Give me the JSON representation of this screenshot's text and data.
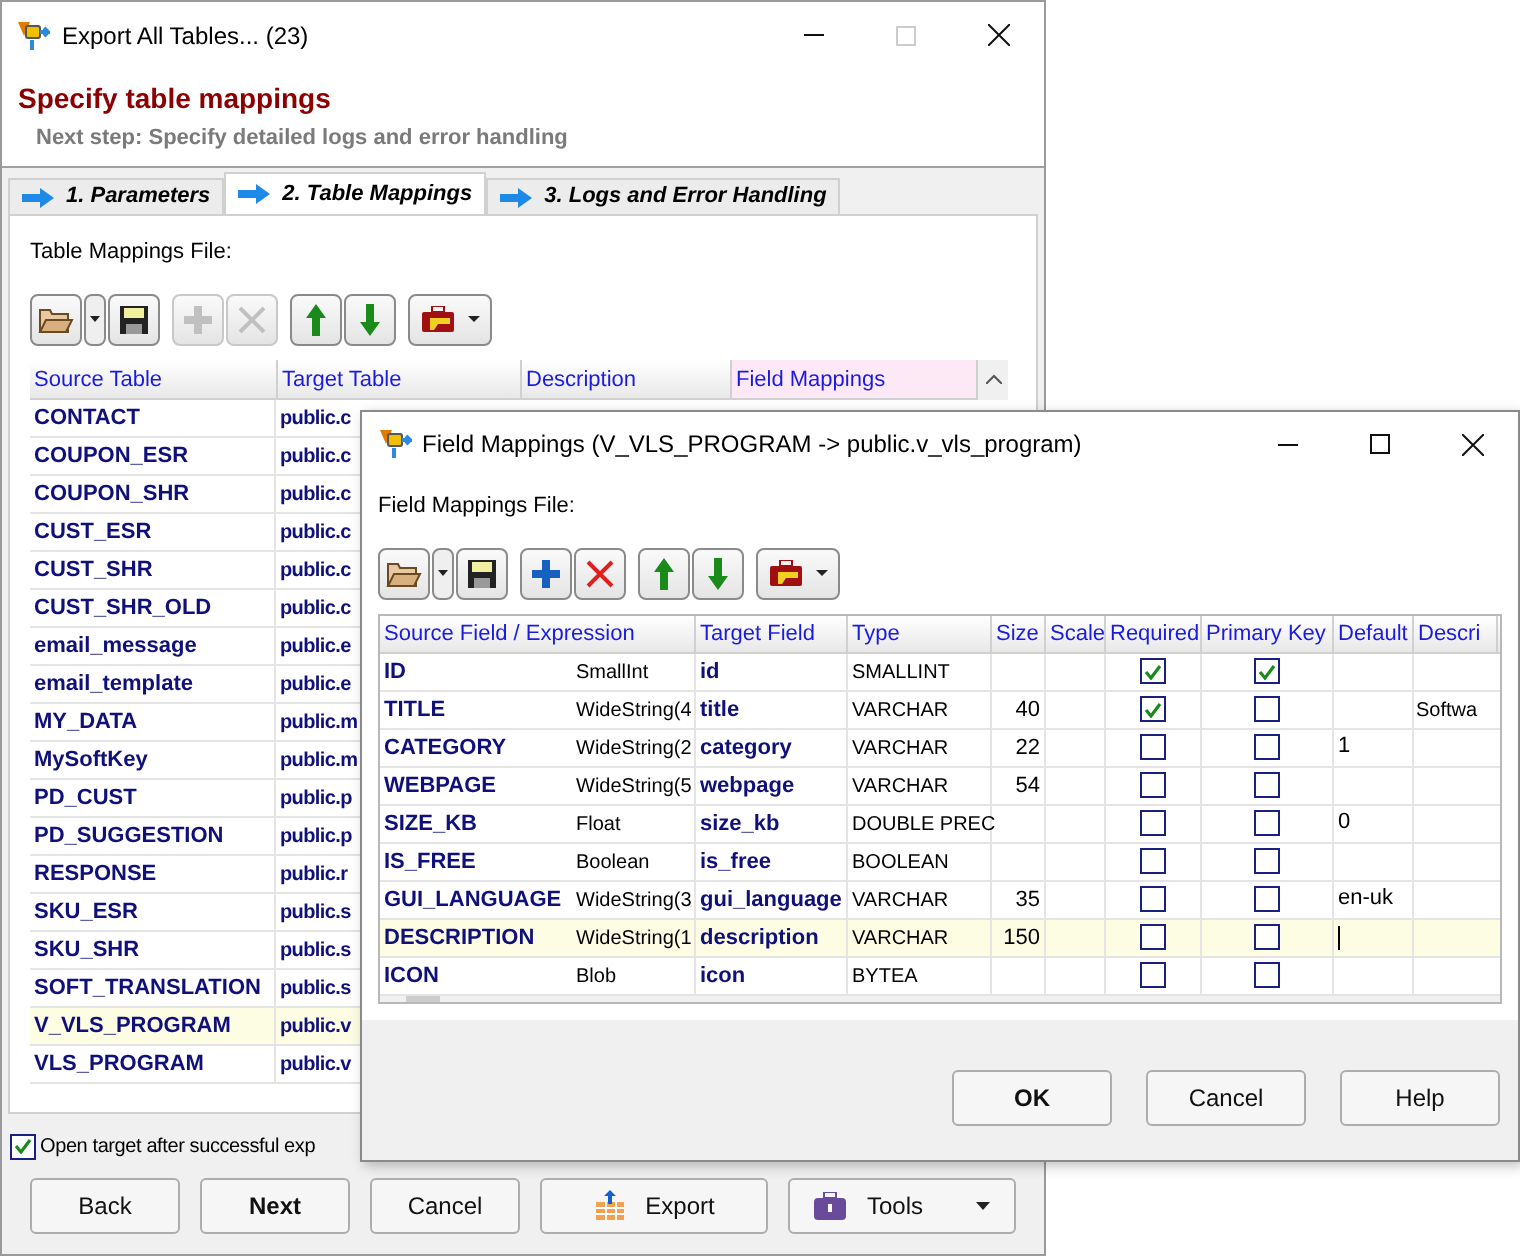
{
  "window": {
    "title": "Export All Tables... (23)"
  },
  "header": {
    "title": "Specify table mappings",
    "subtitle": "Next step: Specify detailed logs and error handling"
  },
  "tabs": [
    {
      "label": "1. Parameters",
      "selected": false
    },
    {
      "label": "2. Table Mappings",
      "selected": true
    },
    {
      "label": "3. Logs and Error Handling",
      "selected": false
    }
  ],
  "file_label": "Table Mappings File:",
  "table": {
    "columns": [
      "Source Table",
      "Target Table",
      "Description",
      "Field Mappings"
    ],
    "rows": [
      {
        "source": "CONTACT",
        "target": "public.c",
        "selected": false
      },
      {
        "source": "COUPON_ESR",
        "target": "public.c",
        "selected": false
      },
      {
        "source": "COUPON_SHR",
        "target": "public.c",
        "selected": false
      },
      {
        "source": "CUST_ESR",
        "target": "public.c",
        "selected": false
      },
      {
        "source": "CUST_SHR",
        "target": "public.c",
        "selected": false
      },
      {
        "source": "CUST_SHR_OLD",
        "target": "public.c",
        "selected": false
      },
      {
        "source": "email_message",
        "target": "public.e",
        "selected": false
      },
      {
        "source": "email_template",
        "target": "public.e",
        "selected": false
      },
      {
        "source": "MY_DATA",
        "target": "public.m",
        "selected": false
      },
      {
        "source": "MySoftKey",
        "target": "public.m",
        "selected": false
      },
      {
        "source": "PD_CUST",
        "target": "public.p",
        "selected": false
      },
      {
        "source": "PD_SUGGESTION",
        "target": "public.p",
        "selected": false
      },
      {
        "source": "RESPONSE",
        "target": "public.r",
        "selected": false
      },
      {
        "source": "SKU_ESR",
        "target": "public.s",
        "selected": false
      },
      {
        "source": "SKU_SHR",
        "target": "public.s",
        "selected": false
      },
      {
        "source": "SOFT_TRANSLATION",
        "target": "public.s",
        "selected": false
      },
      {
        "source": "V_VLS_PROGRAM",
        "target": "public.v",
        "selected": true
      },
      {
        "source": "VLS_PROGRAM",
        "target": "public.v",
        "selected": false
      }
    ]
  },
  "open_target": {
    "label": "Open target after successful exp",
    "checked": true
  },
  "buttons": [
    "Back",
    "Next",
    "Cancel",
    "Export",
    "Tools"
  ],
  "dialog": {
    "title": "Field Mappings (V_VLS_PROGRAM -> public.v_vls_program)",
    "file_label": "Field Mappings File:",
    "columns": [
      "Source Field / Expression",
      "Target Field",
      "Type",
      "Size",
      "Scale",
      "Required",
      "Primary Key",
      "Default",
      "Descri"
    ],
    "rows": [
      {
        "source": "ID",
        "source_type": "SmallInt",
        "target": "id",
        "type": "SMALLINT",
        "size": "",
        "default": "",
        "description": "",
        "required": true,
        "primary_key": true,
        "selected": false
      },
      {
        "source": "TITLE",
        "source_type": "WideString(4",
        "target": "title",
        "type": "VARCHAR",
        "size": "40",
        "default": "",
        "description": "Softwa",
        "required": true,
        "primary_key": false,
        "selected": false
      },
      {
        "source": "CATEGORY",
        "source_type": "WideString(2",
        "target": "category",
        "type": "VARCHAR",
        "size": "22",
        "default": "1",
        "description": "",
        "required": false,
        "primary_key": false,
        "selected": false
      },
      {
        "source": "WEBPAGE",
        "source_type": "WideString(5",
        "target": "webpage",
        "type": "VARCHAR",
        "size": "54",
        "default": "",
        "description": "",
        "required": false,
        "primary_key": false,
        "selected": false
      },
      {
        "source": "SIZE_KB",
        "source_type": "Float",
        "target": "size_kb",
        "type": "DOUBLE PREC",
        "size": "",
        "default": "0",
        "description": "",
        "required": false,
        "primary_key": false,
        "selected": false
      },
      {
        "source": "IS_FREE",
        "source_type": "Boolean",
        "target": "is_free",
        "type": "BOOLEAN",
        "size": "",
        "default": "",
        "description": "",
        "required": false,
        "primary_key": false,
        "selected": false
      },
      {
        "source": "GUI_LANGUAGE",
        "source_type": "WideString(3",
        "target": "gui_language",
        "type": "VARCHAR",
        "size": "35",
        "default": "en-uk",
        "description": "",
        "required": false,
        "primary_key": false,
        "selected": false
      },
      {
        "source": "DESCRIPTION",
        "source_type": "WideString(1",
        "target": "description",
        "type": "VARCHAR",
        "size": "150",
        "default": "",
        "description": "",
        "required": false,
        "primary_key": false,
        "selected": true
      },
      {
        "source": "ICON",
        "source_type": "Blob",
        "target": "icon",
        "type": "BYTEA",
        "size": "",
        "default": "",
        "description": "",
        "required": false,
        "primary_key": false,
        "selected": false
      }
    ],
    "buttons": [
      "OK",
      "Cancel",
      "Help"
    ]
  }
}
